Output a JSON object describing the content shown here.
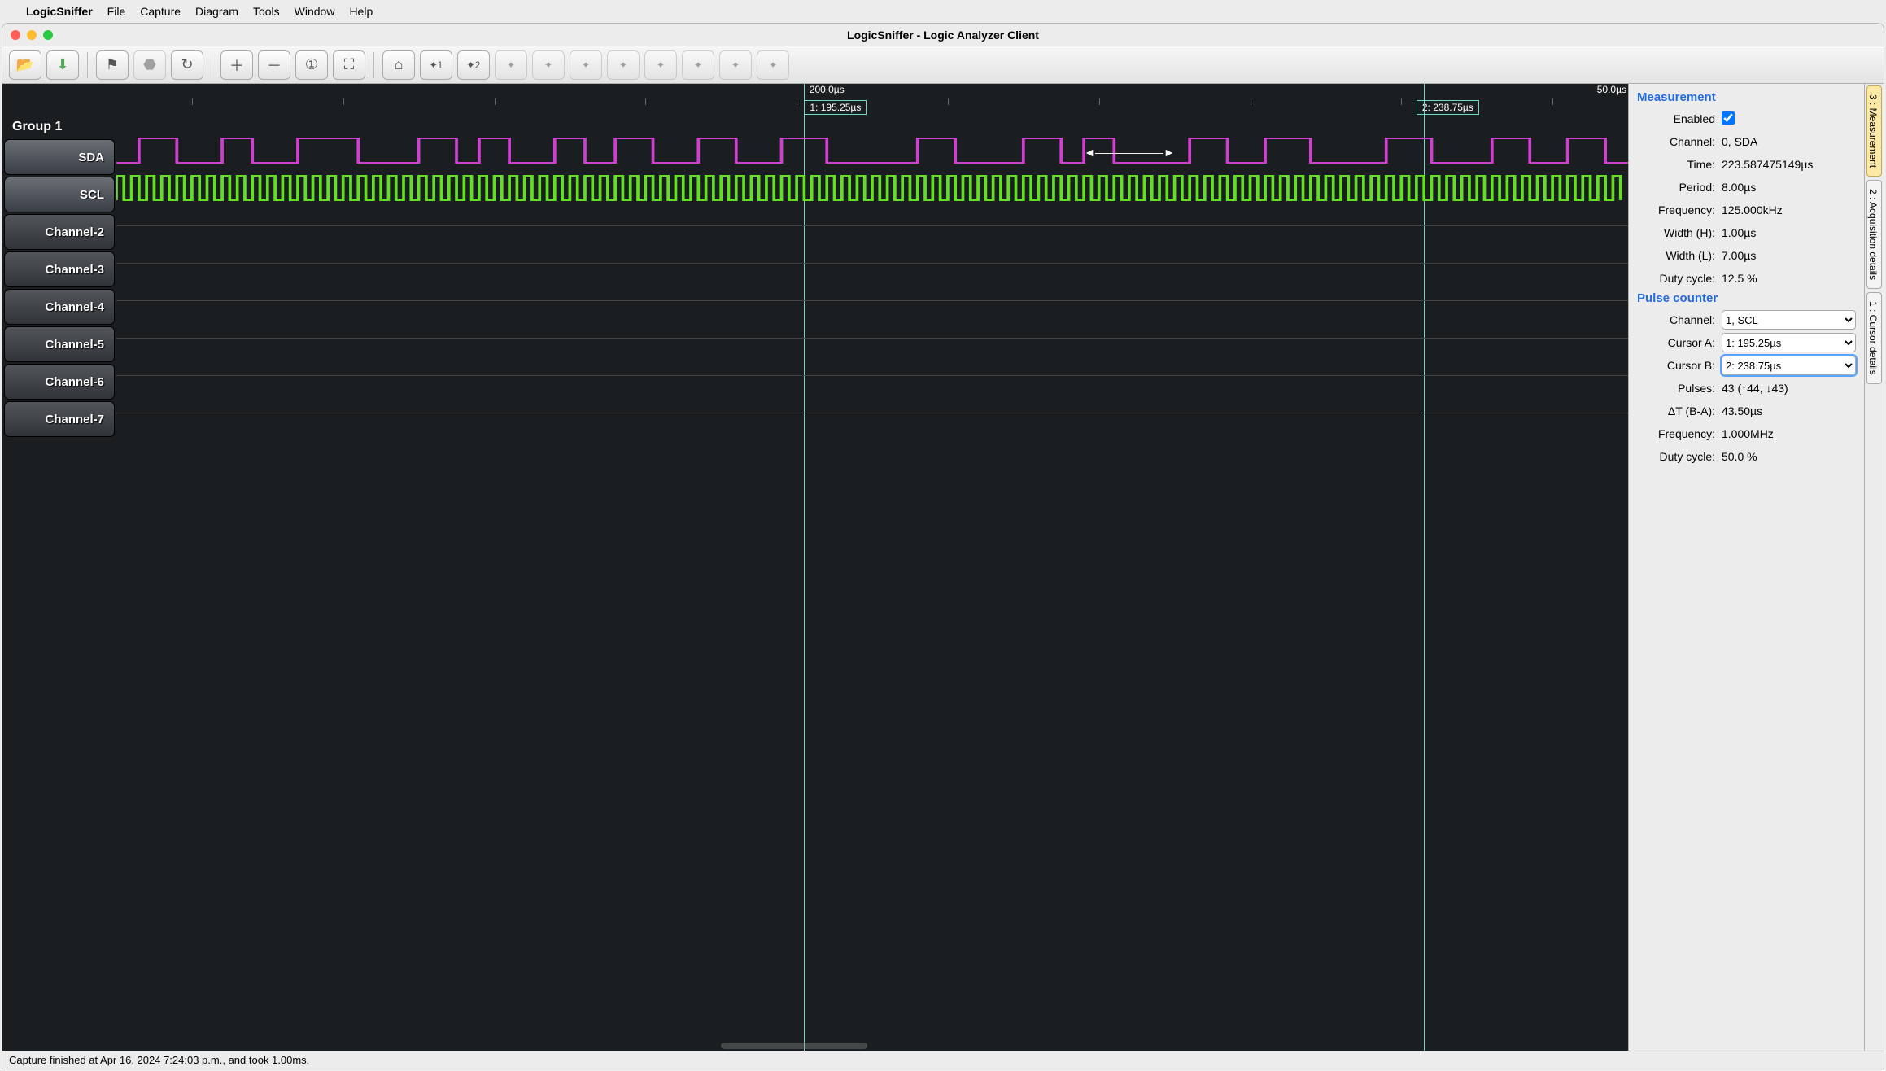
{
  "menubar": {
    "app_name": "LogicSniffer",
    "items": [
      "File",
      "Capture",
      "Diagram",
      "Tools",
      "Window",
      "Help"
    ]
  },
  "window": {
    "title": "LogicSniffer - Logic Analyzer Client"
  },
  "time_axis": {
    "center_label": "200.0µs",
    "right_label": "50.0µs"
  },
  "cursors": {
    "c1": "1: 195.25µs",
    "c2": "2: 238.75µs"
  },
  "channels": {
    "group": "Group 1",
    "list": [
      "SDA",
      "SCL",
      "Channel-2",
      "Channel-3",
      "Channel-4",
      "Channel-5",
      "Channel-6",
      "Channel-7"
    ]
  },
  "measurement": {
    "heading": "Measurement",
    "rows": {
      "enabled_label": "Enabled",
      "enabled": true,
      "channel_label": "Channel:",
      "channel": "0, SDA",
      "time_label": "Time:",
      "time": "223.587475149µs",
      "period_label": "Period:",
      "period": "8.00µs",
      "frequency_label": "Frequency:",
      "frequency": "125.000kHz",
      "widthH_label": "Width (H):",
      "widthH": "1.00µs",
      "widthL_label": "Width (L):",
      "widthL": "7.00µs",
      "duty_label": "Duty cycle:",
      "duty": "12.5 %"
    }
  },
  "pulse_counter": {
    "heading": "Pulse counter",
    "channel_label": "Channel:",
    "channel_options": [
      "1, SCL"
    ],
    "cursorA_label": "Cursor A:",
    "cursorA_options": [
      "1: 195.25µs"
    ],
    "cursorB_label": "Cursor B:",
    "cursorB_options": [
      "2: 238.75µs"
    ],
    "pulses_label": "Pulses:",
    "pulses": "43 (↑44, ↓43)",
    "dt_label": "ΔT (B-A):",
    "dt": "43.50µs",
    "frequency_label": "Frequency:",
    "frequency": "1.000MHz",
    "duty_label": "Duty cycle:",
    "duty": "50.0 %"
  },
  "vertical_tabs": {
    "t3": "3 : Measurement",
    "t2": "2 : Acquisition details",
    "t1": "1 : Cursor details"
  },
  "status": "Capture finished at Apr 16, 2024 7:24:03 p.m., and took 1.00ms."
}
